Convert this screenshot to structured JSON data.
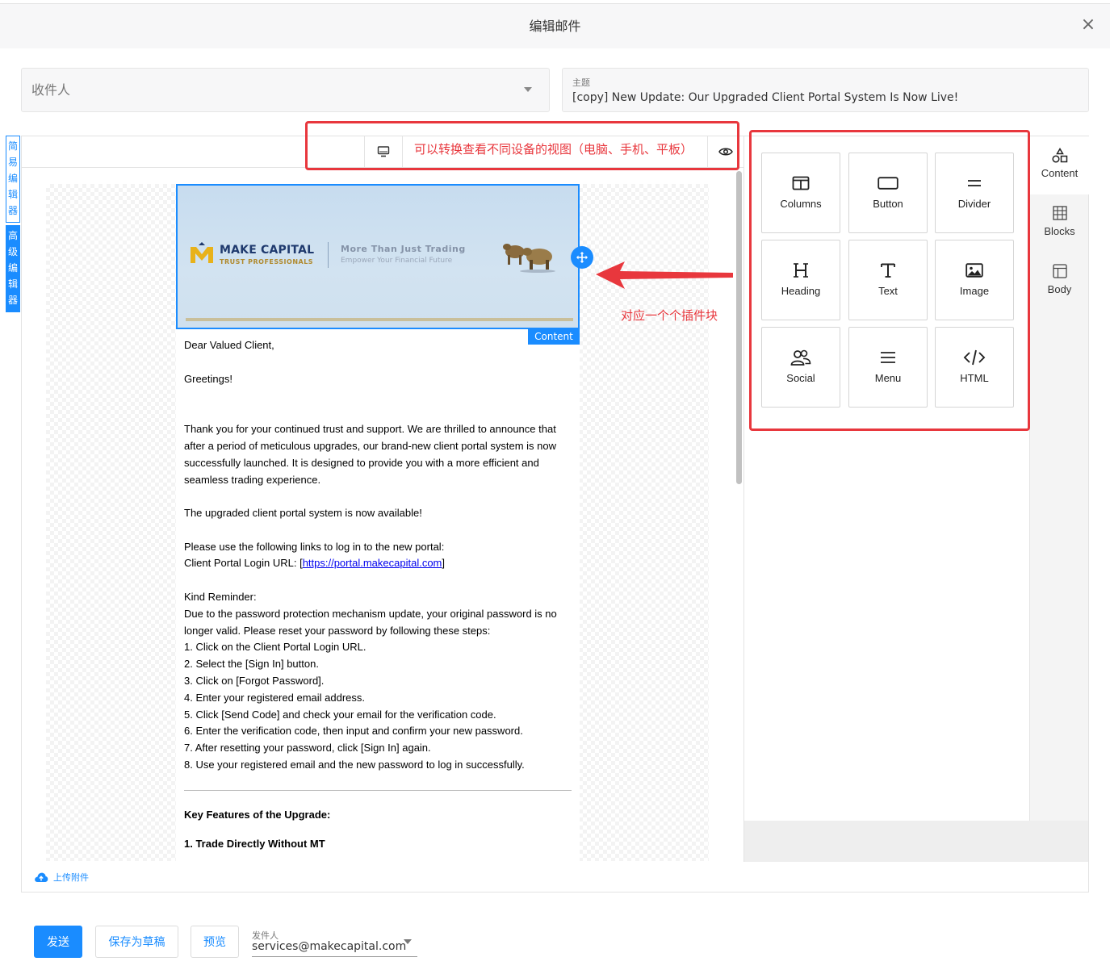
{
  "header": {
    "title": "编辑邮件",
    "close_icon": "×"
  },
  "recipient": {
    "placeholder": "收件人"
  },
  "subject": {
    "label": "主题",
    "value": "[copy] New Update: Our Upgraded Client Portal System Is Now Live!"
  },
  "side_tabs": {
    "simple_chars": [
      "简",
      "易",
      "编",
      "辑",
      "器"
    ],
    "advanced_chars": [
      "高",
      "级",
      "编",
      "辑",
      "器"
    ]
  },
  "annotations": {
    "device_note": "可以转换查看不同设备的视图（电脑、手机、平板）",
    "block_note": "对应一个个插件块",
    "color": "#e8373d"
  },
  "banner": {
    "brand": "MAKE CAPITAL",
    "brand_sub": "TRUST PROFESSIONALS",
    "tagline": "More Than Just Trading",
    "tagline_sub": "Empower Your Financial Future",
    "content_tag": "Content"
  },
  "email": {
    "greeting": "Dear Valued Client,",
    "greetings2": "Greetings!",
    "intro": "Thank you for your continued trust and support. We are thrilled to announce that after a period of meticulous upgrades, our brand-new client portal system is now successfully launched. It is designed to provide you with a more efficient and seamless trading experience.",
    "available": "The upgraded client portal system is now available!",
    "links_intro": "Please use the following links to log in to the new portal:",
    "login_label": "Client Portal Login URL: [",
    "login_url": "https://portal.makecapital.com",
    "login_close": "]",
    "reminder_title": "Kind Reminder:",
    "reminder_text": "Due to the password protection mechanism update, your original password is no longer valid. Please reset your password by following these steps:",
    "steps": [
      "1. Click on the Client Portal Login URL.",
      "2. Select the [Sign In] button.",
      "3. Click on [Forgot Password].",
      "4. Enter your registered email address.",
      "5. Click [Send Code] and check your email for the verification code.",
      "6. Enter the verification code, then input and confirm your new password.",
      "7. After resetting your password, click [Sign In] again.",
      "8. Use your registered email and the new password to log in successfully."
    ],
    "features_title": "Key Features of the Upgrade:",
    "feature1": "1. Trade Directly Without MT"
  },
  "tools": [
    {
      "label": "Columns",
      "icon": "columns-icon"
    },
    {
      "label": "Button",
      "icon": "button-icon"
    },
    {
      "label": "Divider",
      "icon": "divider-icon"
    },
    {
      "label": "Heading",
      "icon": "heading-icon"
    },
    {
      "label": "Text",
      "icon": "text-icon"
    },
    {
      "label": "Image",
      "icon": "image-icon"
    },
    {
      "label": "Social",
      "icon": "social-icon"
    },
    {
      "label": "Menu",
      "icon": "menu-icon"
    },
    {
      "label": "HTML",
      "icon": "html-icon"
    }
  ],
  "right_tabs": {
    "content": "Content",
    "blocks": "Blocks",
    "body": "Body"
  },
  "upload": {
    "label": "上传附件"
  },
  "footer": {
    "send": "发送",
    "draft": "保存为草稿",
    "preview": "预览",
    "sender_label": "发件人",
    "sender_value": "services@makecapital.com"
  },
  "colors": {
    "accent": "#1a8cff",
    "annotation": "#e8373d"
  }
}
